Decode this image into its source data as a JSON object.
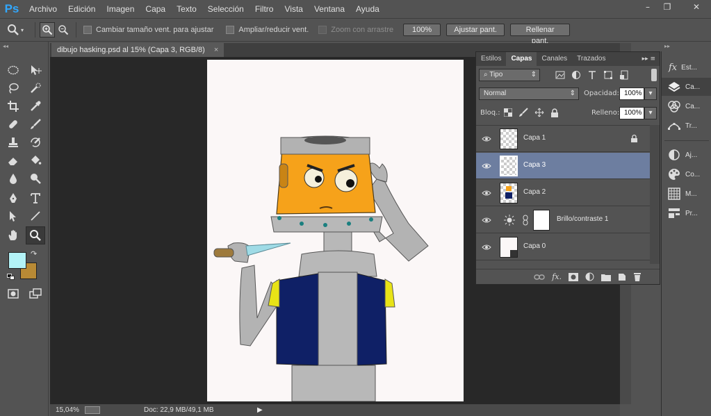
{
  "app": {
    "logo": "Ps"
  },
  "menu": [
    "Archivo",
    "Edición",
    "Imagen",
    "Capa",
    "Texto",
    "Selección",
    "Filtro",
    "Vista",
    "Ventana",
    "Ayuda"
  ],
  "window_controls": {
    "minimize": "–",
    "restore": "❐",
    "close": "✕"
  },
  "options_bar": {
    "resize_windows_label": "Cambiar tamaño vent. para ajustar",
    "zoom_all_label": "Ampliar/reducir vent.",
    "scrubby_zoom_label": "Zoom con arrastre",
    "zoom_value": "100%",
    "fit_screen_label": "Ajustar pant.",
    "fill_screen_label": "Rellenar pant."
  },
  "document": {
    "tab_title": "dibujo hasking.psd al 15% (Capa 3, RGB/8)",
    "close": "×"
  },
  "status": {
    "zoom": "15,04%",
    "doc_size": "Doc: 22,9 MB/49,1 MB",
    "arrow": "▶"
  },
  "colors": {
    "foreground": "#b3f3f7",
    "background": "#b88a35",
    "selected_layer": "#6d7ea0"
  },
  "layers_panel": {
    "tabs": [
      "Estilos",
      "Capas",
      "Canales",
      "Trazados"
    ],
    "active_tab": "Capas",
    "filter_kind": "Tipo",
    "blend_mode": "Normal",
    "opacity_label": "Opacidad:",
    "opacity": "100%",
    "lock_label": "Bloq.:",
    "fill_label": "Relleno:",
    "fill": "100%",
    "layers": [
      {
        "name": "Capa 1",
        "locked": true,
        "selected": false
      },
      {
        "name": "Capa 3",
        "locked": false,
        "selected": true
      },
      {
        "name": "Capa 2",
        "locked": false,
        "selected": false
      },
      {
        "name": "Brillo/contraste 1",
        "locked": false,
        "selected": false
      },
      {
        "name": "Capa 0",
        "locked": false,
        "selected": false
      }
    ]
  },
  "right_dock": [
    {
      "label": "Est...",
      "icon": "fx-icon"
    },
    {
      "label": "Ca...",
      "icon": "layers-icon"
    },
    {
      "label": "Ca...",
      "icon": "channels-icon"
    },
    {
      "label": "Tr...",
      "icon": "paths-icon"
    },
    {
      "label": "Aj...",
      "icon": "adjustments-icon"
    },
    {
      "label": "Co...",
      "icon": "color-palette-icon"
    },
    {
      "label": "M...",
      "icon": "swatches-icon"
    },
    {
      "label": "Pr...",
      "icon": "properties-icon"
    }
  ]
}
